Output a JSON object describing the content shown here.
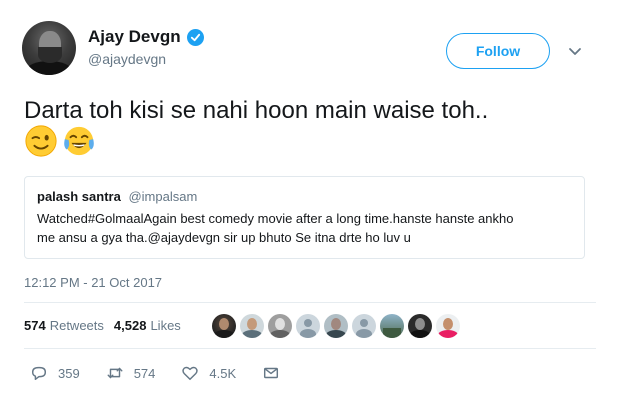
{
  "author": {
    "name": "Ajay Devgn",
    "handle": "@ajaydevgn",
    "avatar_icon": "profile-photo"
  },
  "follow_label": "Follow",
  "tweet": {
    "text": "Darta toh kisi se nahi hoon main waise toh..",
    "emojis": [
      "winking-face",
      "face-with-tears-of-joy"
    ]
  },
  "quoted": {
    "name": "palash santra",
    "handle": "@impalsam",
    "text_line1": "Watched#GolmaalAgain best comedy movie after a long time.hanste hanste ankho",
    "text_line2": "me ansu a gya tha.@ajaydevgn sir up bhuto Se itna drte ho luv u"
  },
  "timestamp": "12:12 PM - 21 Oct 2017",
  "stats": {
    "retweets_count": "574",
    "retweets_label": "Retweets",
    "likes_count": "4,528",
    "likes_label": "Likes"
  },
  "likers": [
    "photo",
    "photo",
    "photo",
    "default",
    "photo",
    "default",
    "photo",
    "photo",
    "default"
  ],
  "actions": {
    "replies": "359",
    "retweets": "574",
    "likes": "4.5K"
  },
  "colors": {
    "accent": "#1da1f2",
    "secondary_text": "#657786",
    "border": "#e1e8ed"
  }
}
